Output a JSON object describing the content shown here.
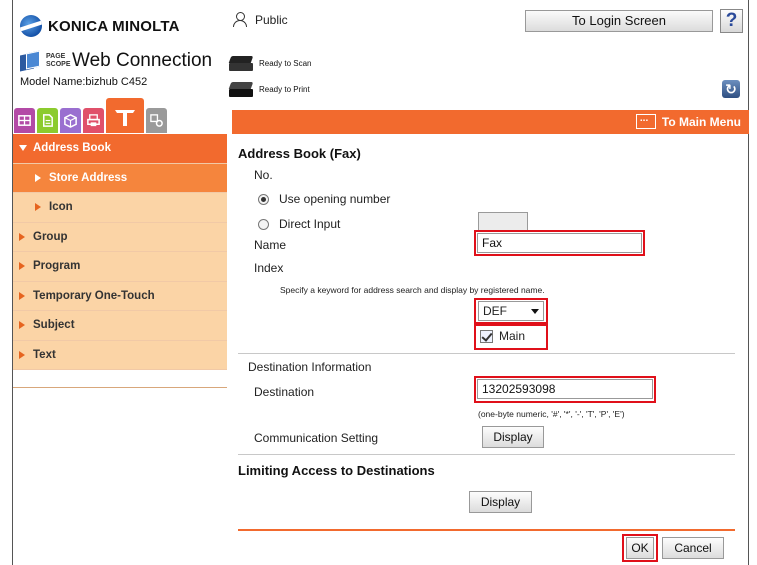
{
  "brand": {
    "name": "KONICA MINOLTA"
  },
  "pagescope": {
    "small_label": "PAGE SCOPE",
    "title": "Web Connection"
  },
  "model": {
    "text": "Model Name:bizhub C452"
  },
  "user": {
    "name": "Public"
  },
  "header": {
    "login_label": "To Login Screen",
    "help_label": "?"
  },
  "status": {
    "scan": "Ready to Scan",
    "print": "Ready to Print"
  },
  "toolbar": {
    "main_menu_label": "To Main Menu"
  },
  "sidebar": {
    "items": [
      {
        "label": "Address Book"
      },
      {
        "label": "Store Address"
      },
      {
        "label": "Icon"
      },
      {
        "label": "Group"
      },
      {
        "label": "Program"
      },
      {
        "label": "Temporary One-Touch"
      },
      {
        "label": "Subject"
      },
      {
        "label": "Text"
      }
    ]
  },
  "form": {
    "title": "Address Book (Fax)",
    "no_label": "No.",
    "radio_opening": "Use opening number",
    "radio_direct": "Direct Input",
    "name_label": "Name",
    "name_value": "Fax",
    "index_label": "Index",
    "index_hint": "Specify a keyword for address search and display by registered name.",
    "index_value": "DEF",
    "main_label": "Main",
    "dest_section": "Destination Information",
    "dest_label": "Destination",
    "dest_value": "13202593098",
    "dest_hint": "(one-byte numeric, '#', '*', '-', 'T', 'P', 'E')",
    "comm_label": "Communication Setting",
    "display_label": "Display",
    "limit_title": "Limiting Access to Destinations",
    "ok_label": "OK",
    "cancel_label": "Cancel"
  },
  "colors": {
    "accent": "#f26a2e",
    "highlight": "#e0101a",
    "sidebar_bg": "#fbd4a6"
  },
  "icons": [
    "globe-logo",
    "pagescope-logo",
    "user-icon",
    "scanner-icon",
    "printer-icon",
    "refresh-icon",
    "menu-icon",
    "help-icon"
  ]
}
